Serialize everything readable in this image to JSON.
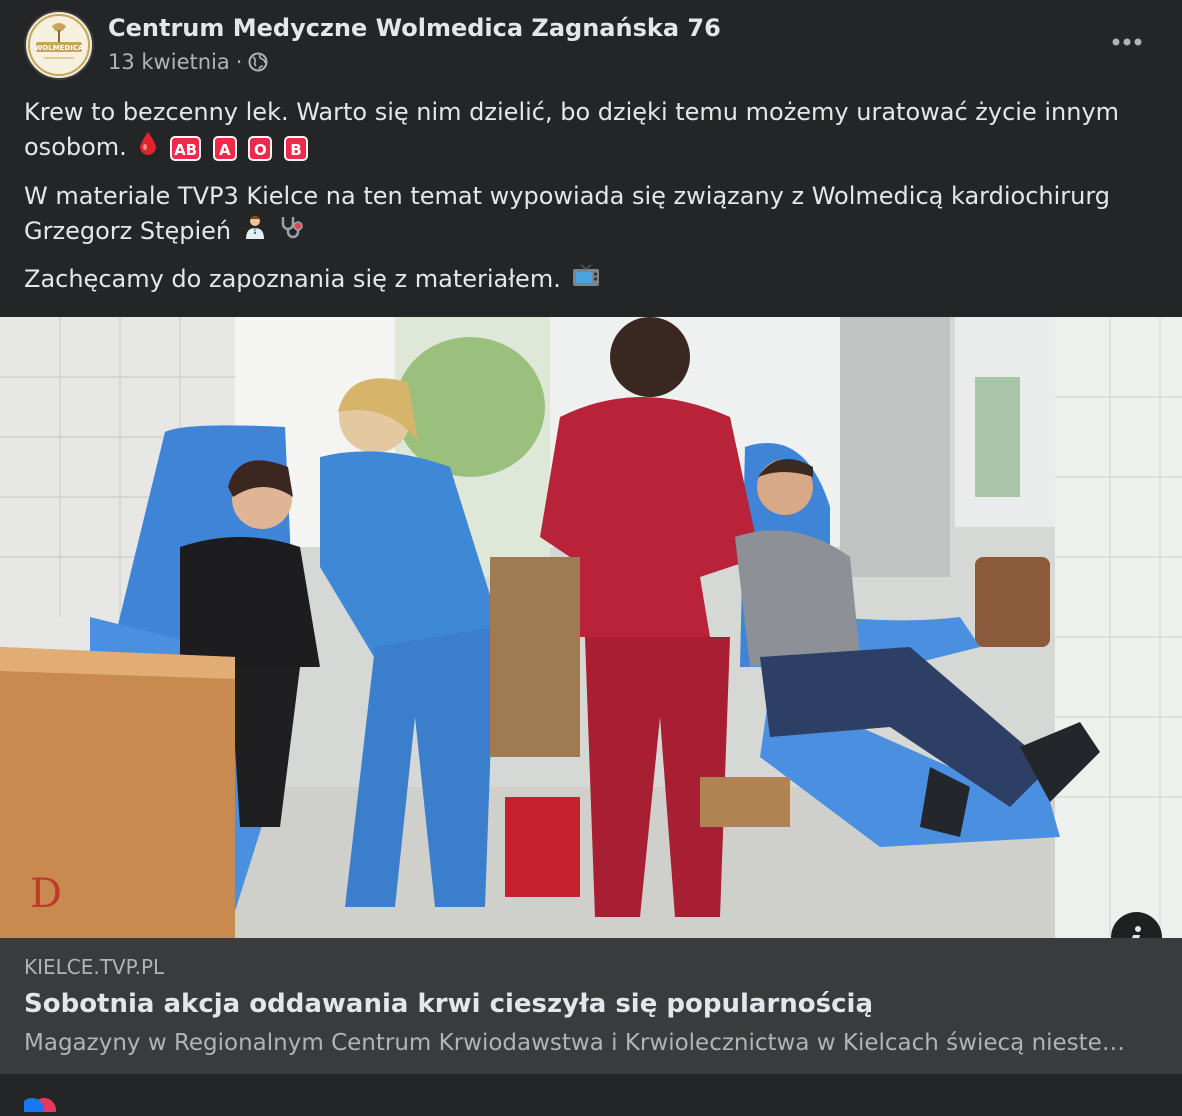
{
  "post": {
    "page_name": "Centrum Medyczne Wolmedica Zagnańska 76",
    "date": "13 kwietnia",
    "separator": "·",
    "privacy_icon": "globe-icon",
    "more_icon": "more-options-icon",
    "avatar_logo_text": "WOLMEDICA",
    "paragraph1": "Krew to bezcenny lek. Warto się nim dzielić, bo dzięki temu możemy uratować życie innym osobom.",
    "paragraph1_emoji": [
      "drop-of-blood",
      "AB",
      "A",
      "O",
      "B"
    ],
    "paragraph2": "W materiale TVP3 Kielce na ten temat wypowiada się związany z Wolmedicą kardiochirurg Grzegorz Stępień",
    "paragraph2_emoji": [
      "health-worker",
      "stethoscope"
    ],
    "paragraph3": "Zachęcamy do zapoznania się z materiałem.",
    "paragraph3_emoji": [
      "television"
    ]
  },
  "link_preview": {
    "domain": "KIELCE.TVP.PL",
    "title": "Sobotnia akcja oddawania krwi cieszyła się popularnością",
    "description": "Magazyny w Regionalnym Centrum Krwiodawstwa i Krwiolecznictwa w Kielcach świecą niestet…",
    "image_description_icon": "info-icon"
  },
  "colors": {
    "background": "#242526",
    "link_box": "#3a3b3c",
    "primary_text": "#e4e6eb",
    "secondary_text": "#b0b3b8",
    "badge_red": "#f02849"
  }
}
